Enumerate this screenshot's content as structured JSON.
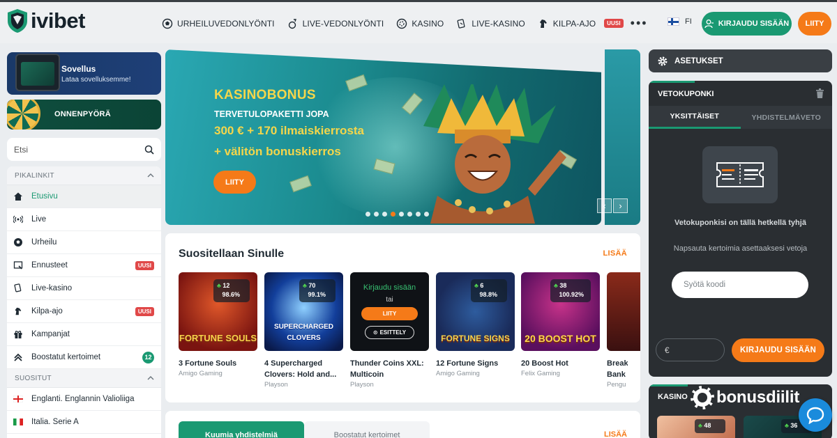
{
  "header": {
    "logo_text": "ivibet",
    "nav": [
      {
        "label": "URHEILUVEDONLYÖNTI",
        "icon": "soccer-ball-icon"
      },
      {
        "label": "LIVE-VEDONLYÖNTI",
        "icon": "live-ball-icon"
      },
      {
        "label": "KASINO",
        "icon": "chip-icon"
      },
      {
        "label": "LIVE-KASINO",
        "icon": "cards-icon"
      },
      {
        "label": "KILPA-AJO",
        "icon": "horse-icon",
        "badge": "UUSI"
      }
    ],
    "more_label": "•••",
    "language": "FI",
    "login_label": "KIRJAUDU SISÄÄN",
    "join_label": "LIITY"
  },
  "sidebar": {
    "app_card": {
      "title": "Sovellus",
      "subtitle": "Lataa sovelluksemme!"
    },
    "wheel_card": {
      "title": "ONNENPYÖRÄ"
    },
    "search_placeholder": "Etsi",
    "quicklinks_header": "PIKALINKIT",
    "quicklinks": [
      {
        "label": "Etusivu",
        "icon": "home-icon",
        "active": true
      },
      {
        "label": "Live",
        "icon": "broadcast-icon"
      },
      {
        "label": "Urheilu",
        "icon": "football-icon"
      },
      {
        "label": "Ennusteet",
        "icon": "prediction-icon",
        "badge": "UUSI"
      },
      {
        "label": "Live-kasino",
        "icon": "cards-icon"
      },
      {
        "label": "Kilpa-ajo",
        "icon": "horse-icon",
        "badge": "UUSI"
      },
      {
        "label": "Kampanjat",
        "icon": "gift-icon"
      },
      {
        "label": "Boostatut kertoimet",
        "icon": "boost-icon",
        "count": "12"
      }
    ],
    "popular_header": "SUOSITUT",
    "popular": [
      {
        "label": "Englanti. Englannin Valioliiga",
        "icon": "england-flag-icon"
      },
      {
        "label": "Italia. Serie A",
        "icon": "italy-flag-icon"
      }
    ]
  },
  "banner": {
    "title": "KASINOBONUS",
    "line1": "TERVETULOPAKETTI JOPA",
    "line2": "300 € + 170 ilmaiskierrosta",
    "line3": "+ välitön bonuskierros",
    "button": "LIITY",
    "slide_count": 8,
    "active_slide": 3
  },
  "recommended": {
    "title": "Suositellaan Sinulle",
    "more": "LISÄÄ",
    "games": [
      {
        "name": "3 Fortune Souls",
        "provider": "Amigo Gaming",
        "count": "12",
        "rtp": "98.6%",
        "art": "FORTUNE SOULS"
      },
      {
        "name": "4 Supercharged Clovers: Hold and...",
        "provider": "Playson",
        "count": "70",
        "rtp": "99.1%",
        "art": "SUPERCHARGED CLOVERS"
      },
      {
        "name": "Thunder Coins XXL: Multicoin",
        "provider": "Playson",
        "overlay_login": "Kirjaudu sisään",
        "overlay_or": "tai",
        "overlay_join": "LIITY",
        "overlay_demo": "ESITTELY"
      },
      {
        "name": "12 Fortune Signs",
        "provider": "Amigo Gaming",
        "count": "6",
        "rtp": "98.8%",
        "art": "FORTUNE SIGNS"
      },
      {
        "name": "20 Boost Hot",
        "provider": "Felix Gaming",
        "count": "38",
        "rtp": "100.92%",
        "art": "20 BOOST HOT"
      },
      {
        "name": "Break Bank",
        "provider": "Pengu"
      }
    ]
  },
  "combos": {
    "tab_hot": "Kuumia yhdistelmiä",
    "tab_boost": "Boostatut kertoimet",
    "more": "LISÄÄ"
  },
  "betslip": {
    "settings_label": "ASETUKSET",
    "title": "VETOKUPONKI",
    "tab_single": "YKSITTÄISET",
    "tab_combo": "YHDISTELMÄVETO",
    "empty_text": "Vetokuponkisi on tällä hetkellä tyhjä",
    "hint_text": "Napsauta kertoimia asettaaksesi vetoja",
    "code_placeholder": "Syötä koodi",
    "stake_currency": "€",
    "login_label": "KIRJAUDU SISÄÄN"
  },
  "casino_widget": {
    "title": "KASINO",
    "brand": "bonusdiilit",
    "tiles": [
      {
        "count": "48"
      },
      {
        "count": "36"
      }
    ]
  },
  "colors": {
    "brand_green": "#1a9972",
    "accent_orange": "#f57a18",
    "badge_red": "#e04848",
    "dark_panel": "#2a2e32"
  }
}
